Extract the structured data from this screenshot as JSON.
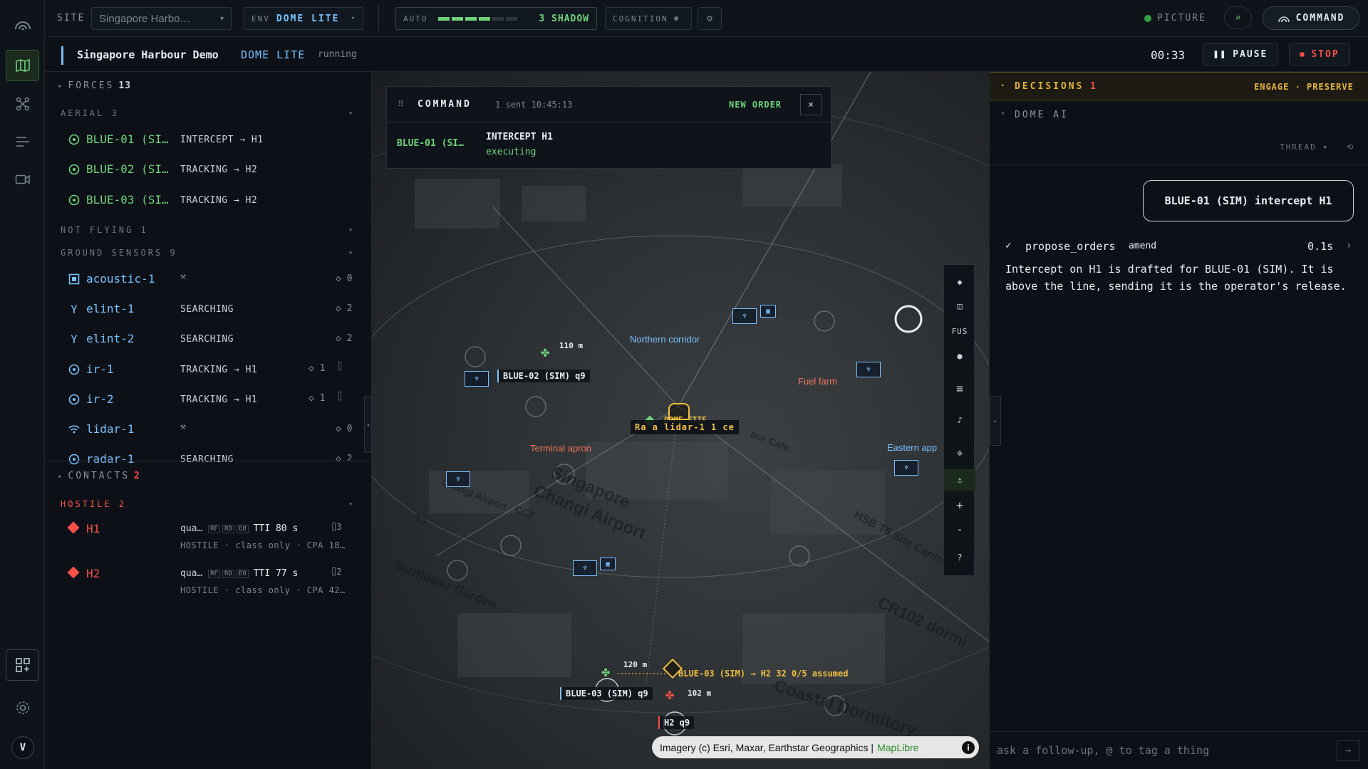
{
  "topbar": {
    "site_label": "SITE",
    "site_value": "Singapore Harbo…",
    "env_key": "ENV",
    "env_value": "DOME LITE",
    "auto_label": "AUTO",
    "auto_value": "3 SHADOW",
    "auto_level": 0.67,
    "cognition_label": "COGNITION",
    "picture_label": "PICTURE",
    "command_label": "COMMAND"
  },
  "session": {
    "title": "Singapore Harbour Demo",
    "env": "DOME LITE",
    "status": "running",
    "clock": "00:33",
    "pause_label": "PAUSE",
    "stop_label": "STOP"
  },
  "forces": {
    "title": "FORCES",
    "count": "13",
    "aerial_label": "AERIAL 3",
    "aerial": [
      {
        "name": "BLUE-01 (SI…",
        "task": "INTERCEPT → H1"
      },
      {
        "name": "BLUE-02 (SI…",
        "task": "TRACKING → H2"
      },
      {
        "name": "BLUE-03 (SI…",
        "task": "TRACKING → H2"
      }
    ],
    "not_flying_label": "NOT FLYING 1",
    "ground_label": "GROUND SENSORS 9",
    "ground": [
      {
        "name": "acoustic-1",
        "task": "",
        "count": "0",
        "icon": "square-icon"
      },
      {
        "name": "elint-1",
        "task": "SEARCHING",
        "count": "2",
        "icon": "antenna-icon"
      },
      {
        "name": "elint-2",
        "task": "SEARCHING",
        "count": "2",
        "icon": "antenna-icon"
      },
      {
        "name": "ir-1",
        "task": "TRACKING → H1",
        "count": "1",
        "icon": "target-icon"
      },
      {
        "name": "ir-2",
        "task": "TRACKING → H1",
        "count": "1",
        "icon": "target-icon"
      },
      {
        "name": "lidar-1",
        "task": "",
        "count": "0",
        "icon": "wifi-icon"
      },
      {
        "name": "radar-1",
        "task": "SEARCHING",
        "count": "2",
        "icon": "target-icon"
      }
    ]
  },
  "contacts": {
    "title": "CONTACTS",
    "count": "2",
    "hostile_label": "HOSTILE 2",
    "items": [
      {
        "name": "H1",
        "q": "qua…",
        "tags": [
          "RF",
          "RD",
          "EO"
        ],
        "tti": "TTI 80 s",
        "cams": "3",
        "sub": "HOSTILE · class only · CPA 18…"
      },
      {
        "name": "H2",
        "q": "qua…",
        "tags": [
          "RF",
          "RD",
          "EO"
        ],
        "tti": "TTI 77 s",
        "cams": "2",
        "sub": "HOSTILE · class only · CPA 42…"
      }
    ]
  },
  "command_card": {
    "title": "COMMAND",
    "sent": "1 sent 10:45:13",
    "new_order": "NEW ORDER",
    "close": "×",
    "unit": "BLUE-01 (SI…",
    "order": "INTERCEPT H1",
    "state": "executing"
  },
  "map": {
    "labels": {
      "northern": "Northern corridor",
      "fuel": "Fuel farm",
      "terminal": "Terminal apron",
      "eastern": "Eastern app",
      "dome_site": "DOME SITE",
      "lidar": "Ra a lidar-1 1 ce",
      "singapore": "Singapore",
      "changi": "Changi Airport",
      "dormitory": "Coastal Dormitory",
      "sunflower": "Sunflower Garden",
      "cr102": "CR102 dormi",
      "hsb": "HSB T5 Site Canteen",
      "changi_ap": "Changi Airport",
      "t3": "T3",
      "cc2": "CC2",
      "cafe": "ace Cafe"
    },
    "units": {
      "blue02": "BLUE-02 (SIM) q9",
      "blue02_alt": "110 m",
      "blue03": "BLUE-03 (SIM) q9",
      "blue03_alt": "120 m",
      "h2": "H2 q9",
      "h2_alt": "102 m",
      "assumed": "BLUE-03 (SIM) → H2  32 0/5 assumed"
    },
    "tools": [
      "◆",
      "◫",
      "FUS",
      "●",
      "≡",
      "♪",
      "⌖",
      "⚓",
      "+",
      "-",
      "?"
    ],
    "attribution": "Imagery (c) Esri, Maxar, Earthstar Geographics |",
    "maplibre": "MapLibre"
  },
  "right": {
    "decisions_label": "DECISIONS",
    "decisions_count": "1",
    "decisions_actions": "ENGAGE · PRESERVE",
    "ai_label": "DOME AI",
    "thread_label": "THREAD",
    "bubble": "BLUE-01 (SIM) intercept H1",
    "tool_name": "propose_orders",
    "tool_mode": "amend",
    "tool_time": "0.1s",
    "ai_text": "Intercept on H1 is drafted for BLUE-01 (SIM). It is above the line, sending it is the operator's release.",
    "ask_placeholder": "ask a follow-up, @ to tag a thing"
  },
  "rail": {
    "avatar": "V"
  }
}
